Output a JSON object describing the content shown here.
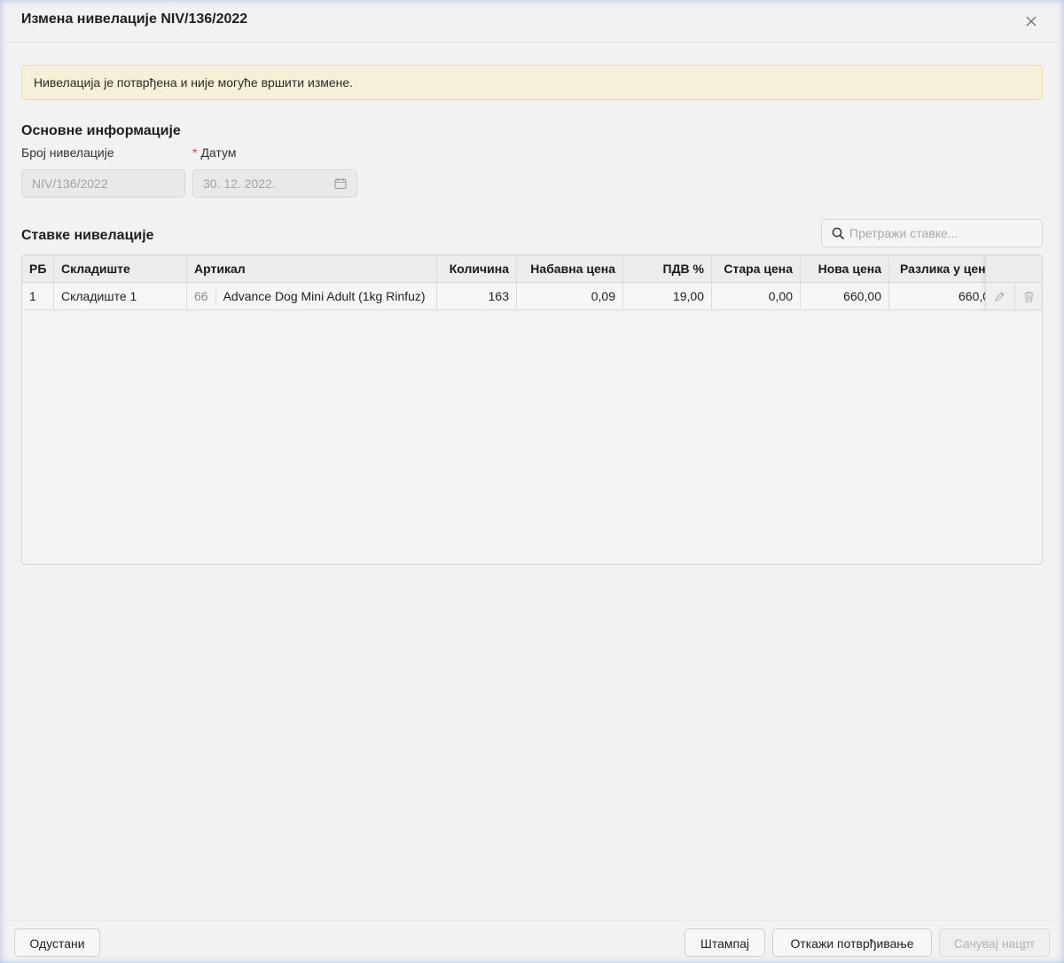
{
  "header": {
    "title": "Измена нивелације NIV/136/2022"
  },
  "alert": {
    "text": "Нивелација је потврђена и није могуће вршити измене."
  },
  "basic_info": {
    "title": "Основне информације",
    "number_label": "Број нивелације",
    "number_value": "NIV/136/2022",
    "date_required_mark": "*",
    "date_label": "Датум",
    "date_value": "30. 12. 2022."
  },
  "items": {
    "title": "Ставке нивелације",
    "search_placeholder": "Претражи ставке...",
    "columns": [
      "РБ",
      "Складиште",
      "Артикал",
      "Количина",
      "Набавна цена",
      "ПДВ %",
      "Стара цена",
      "Нова цена",
      "Разлика у цен"
    ],
    "rows": [
      {
        "rb": "1",
        "warehouse": "Складиште 1",
        "article_code": "66",
        "article_name": "Advance Dog Mini Adult (1kg Rinfuz)",
        "quantity": "163",
        "purchase_price": "0,09",
        "vat": "19,00",
        "old_price": "0,00",
        "new_price": "660,00",
        "difference": "660,0"
      }
    ]
  },
  "footer": {
    "cancel": "Одустани",
    "print": "Штампај",
    "unconfirm": "Откажи потврђивање",
    "save_draft": "Сачувај нацрт"
  },
  "icons": {
    "close": "close-icon",
    "calendar": "calendar-icon",
    "search": "search-icon",
    "edit": "pencil-icon",
    "delete": "trash-icon"
  }
}
